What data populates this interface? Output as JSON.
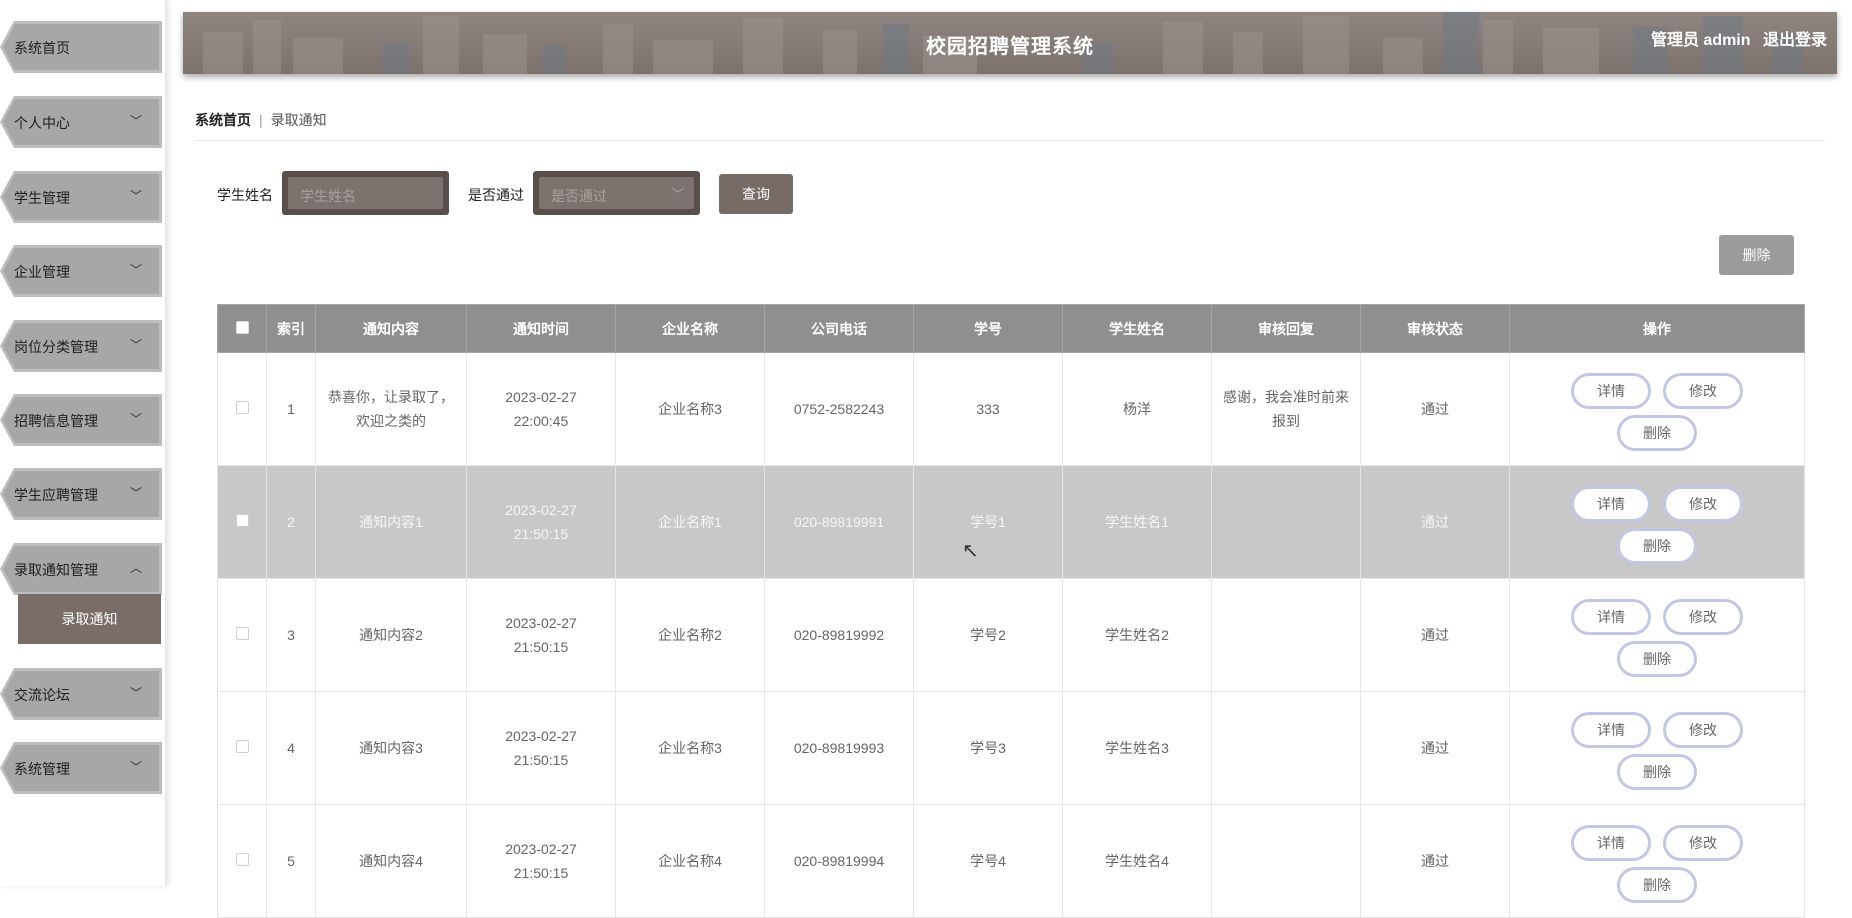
{
  "app": {
    "title": "校园招聘管理系统",
    "user_role": "管理员 admin",
    "logout_label": "退出登录"
  },
  "sidebar": {
    "items": [
      {
        "label": "系统首页",
        "chevron": ""
      },
      {
        "label": "个人中心",
        "chevron": "﹀"
      },
      {
        "label": "学生管理",
        "chevron": "﹀"
      },
      {
        "label": "企业管理",
        "chevron": "﹀"
      },
      {
        "label": "岗位分类管理",
        "chevron": "﹀"
      },
      {
        "label": "招聘信息管理",
        "chevron": "﹀"
      },
      {
        "label": "学生应聘管理",
        "chevron": "﹀"
      },
      {
        "label": "录取通知管理",
        "chevron": "︿"
      },
      {
        "label": "交流论坛",
        "chevron": "﹀"
      },
      {
        "label": "系统管理",
        "chevron": "﹀"
      }
    ],
    "active_sub": "录取通知"
  },
  "breadcrumb": {
    "home": "系统首页",
    "separator": "|",
    "current": "录取通知"
  },
  "search": {
    "name_label": "学生姓名",
    "name_placeholder": "学生姓名",
    "pass_label": "是否通过",
    "pass_placeholder": "是否通过",
    "query_button": "查询"
  },
  "actions": {
    "delete_button": "删除"
  },
  "table": {
    "headers": [
      "索引",
      "通知内容",
      "通知时间",
      "企业名称",
      "公司电话",
      "学号",
      "学生姓名",
      "审核回复",
      "审核状态",
      "操作"
    ],
    "row_buttons": {
      "detail": "详情",
      "edit": "修改",
      "delete": "删除"
    },
    "rows": [
      {
        "index": "1",
        "content": "恭喜你，让录取了，欢迎之类的",
        "time": "2023-02-27 22:00:45",
        "company": "企业名称3",
        "phone": "0752-2582243",
        "student_no": "333",
        "student_name": "杨洋",
        "reply": "感谢，我会准时前来报到",
        "status": "通过"
      },
      {
        "index": "2",
        "content": "通知内容1",
        "time": "2023-02-27 21:50:15",
        "company": "企业名称1",
        "phone": "020-89819991",
        "student_no": "学号1",
        "student_name": "学生姓名1",
        "reply": "",
        "status": "通过"
      },
      {
        "index": "3",
        "content": "通知内容2",
        "time": "2023-02-27 21:50:15",
        "company": "企业名称2",
        "phone": "020-89819992",
        "student_no": "学号2",
        "student_name": "学生姓名2",
        "reply": "",
        "status": "通过"
      },
      {
        "index": "4",
        "content": "通知内容3",
        "time": "2023-02-27 21:50:15",
        "company": "企业名称3",
        "phone": "020-89819993",
        "student_no": "学号3",
        "student_name": "学生姓名3",
        "reply": "",
        "status": "通过"
      },
      {
        "index": "5",
        "content": "通知内容4",
        "time": "2023-02-27 21:50:15",
        "company": "企业名称4",
        "phone": "020-89819994",
        "student_no": "学号4",
        "student_name": "学生姓名4",
        "reply": "",
        "status": "通过"
      }
    ]
  }
}
